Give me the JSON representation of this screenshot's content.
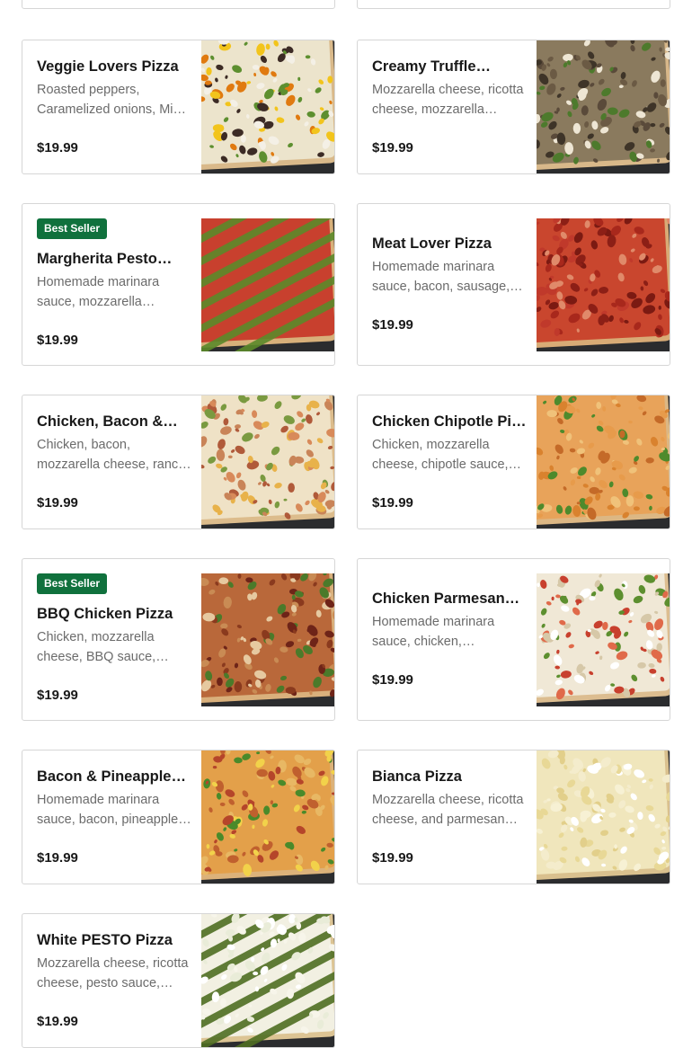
{
  "menu_items": [
    {
      "title": "Veggie Lovers Pizza",
      "description": "Roasted peppers, Caramelized onions, Mi…",
      "price": "$19.99",
      "badge": ""
    },
    {
      "title": "Creamy Truffle…",
      "description": "Mozzarella cheese, ricotta cheese, mozzarella…",
      "price": "$19.99",
      "badge": ""
    },
    {
      "title": "Margherita Pesto…",
      "description": "Homemade marinara sauce, mozzarella chees…",
      "price": "$19.99",
      "badge": "Best Seller"
    },
    {
      "title": "Meat Lover Pizza",
      "description": "Homemade marinara sauce, bacon, sausage,…",
      "price": "$19.99",
      "badge": ""
    },
    {
      "title": "Chicken, Bacon &…",
      "description": "Chicken, bacon, mozzarella cheese, ranc…",
      "price": "$19.99",
      "badge": ""
    },
    {
      "title": "Chicken Chipotle Pizza",
      "description": "Chicken, mozzarella cheese, chipotle sauce,…",
      "price": "$19.99",
      "badge": ""
    },
    {
      "title": "BBQ Chicken Pizza",
      "description": "Chicken, mozzarella cheese, BBQ sauce, oliv…",
      "price": "$19.99",
      "badge": "Best Seller"
    },
    {
      "title": "Chicken Parmesan…",
      "description": "Homemade marinara sauce, chicken,…",
      "price": "$19.99",
      "badge": ""
    },
    {
      "title": "Bacon & Pineapple…",
      "description": "Homemade marinara sauce, bacon, pineapple…",
      "price": "$19.99",
      "badge": ""
    },
    {
      "title": "Bianca Pizza",
      "description": "Mozzarella cheese, ricotta cheese, and parmesan…",
      "price": "$19.99",
      "badge": ""
    },
    {
      "title": "White PESTO Pizza",
      "description": "Mozzarella cheese, ricotta cheese, pesto sauce,…",
      "price": "$19.99",
      "badge": ""
    }
  ],
  "colors": {
    "badge_bg": "#10713d",
    "card_border": "#d6d6d6",
    "text_primary": "#191919",
    "text_secondary": "#6b6b6b",
    "photo_background": "#2b2c2e"
  },
  "icons": {
    "food_photo": "pizza-photo"
  }
}
